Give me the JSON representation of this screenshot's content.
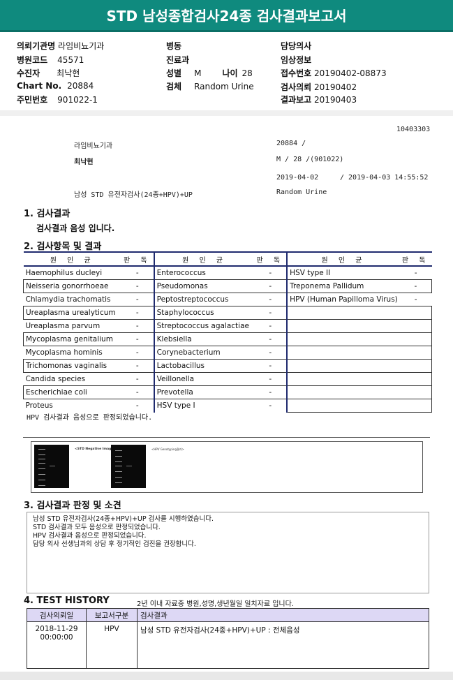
{
  "title": "STD 남성종합검사24종 검사결과보고서",
  "header": {
    "hospital_label": "의뢰기관명",
    "hospital": "라임비뇨기과",
    "code_label": "병원코드",
    "code": "45571",
    "patient_label": "수진자",
    "patient": "최낙현",
    "chart_label": "Chart No.",
    "chart": "20884",
    "id_label": "주민번호",
    "id": "901022-1",
    "ward_label": "병동",
    "dept_label": "진료과",
    "sex_label": "성별",
    "sex": "M",
    "age_label": "나이",
    "age": "28",
    "specimen_label": "검체",
    "specimen": "Random Urine",
    "doctor_label": "담당의사",
    "clinical_label": "임상정보",
    "receipt_label": "접수번호",
    "receipt": "20190402-08873",
    "request_label": "검사의뢰",
    "request": "20190402",
    "report_label": "결과보고",
    "report": "20190403"
  },
  "sub": {
    "docno": "10403303",
    "hospital": "라임비뇨기과",
    "chart_slash": "20884          /",
    "patient": "최낙현",
    "sexage": "M /   28 /(901022)",
    "date1": "2019-04-02",
    "date2": "/ 2019-04-03 14:55:52",
    "testname": "남성 STD 유전자검사(24종+HPV)+UP",
    "specimen": "Random Urine"
  },
  "sec1": {
    "title": "1. 검사결과",
    "text": "검사결과 음성 입니다."
  },
  "sec2": {
    "title": "2. 검사항목 및 결과",
    "head_cause": "원 인 균",
    "head_judge": "판 독",
    "rows": [
      [
        "Haemophilus ducleyi",
        "-",
        "Enterococcus",
        "-",
        "HSV type II",
        "-"
      ],
      [
        "Neisseria gonorrhoeae",
        "-",
        "Pseudomonas",
        "-",
        "Treponema Pallidum",
        "-"
      ],
      [
        "Chlamydia trachomatis",
        "-",
        "Peptostreptococcus",
        "-",
        "HPV (Human Papilloma Virus)",
        "-"
      ],
      [
        "Ureaplasma urealyticum",
        "-",
        "Staphylococcus",
        "-",
        "",
        ""
      ],
      [
        "Ureaplasma parvum",
        "-",
        "Streptococcus agalactiae",
        "-",
        "",
        ""
      ],
      [
        "Mycoplasma genitalium",
        "-",
        "Klebsiella",
        "-",
        "",
        ""
      ],
      [
        "Mycoplasma hominis",
        "-",
        "Corynebacterium",
        "-",
        "",
        ""
      ],
      [
        "Trichomonas vaginalis",
        "-",
        "Lactobacillus",
        "-",
        "",
        ""
      ],
      [
        "Candida species",
        "-",
        "Veillonella",
        "-",
        "",
        ""
      ],
      [
        "Escherichiae coli",
        "-",
        "Prevotella",
        "-",
        "",
        ""
      ],
      [
        "Proteus",
        "-",
        "HSV type I",
        "-",
        "",
        ""
      ]
    ],
    "hpv_note": "HPV 검사결과 음성으로 판정되었습니다."
  },
  "images": {
    "std_label": "<STD Negative Image>",
    "hpv_label": "<HPV Genotyping결과>"
  },
  "sec3": {
    "title": "3. 검사결과 판정 및 소견",
    "lines": [
      "남성 STD 유전자검사(24종+HPV)+UP 검사를 시행하였습니다.",
      "STD 검사결과 모두 음성으로 판정되었습니다.",
      "HPV 검사결과 음성으로 판정되었습니다.",
      "담당 의사 선생님과의 상담 후 정기적인 검진을 권장합니다."
    ]
  },
  "sec4": {
    "title": "4. TEST HISTORY",
    "note": "2년 이내 자료중 병원,성명,생년월일 일치자료 입니다.",
    "col_date": "검사의뢰일",
    "col_type": "보고서구분",
    "col_result": "검사결과",
    "date": "2018-11-29",
    "time": "00:00:00",
    "type": "HPV",
    "result": "남성 STD 유전자검사(24종+HPV)+UP : 전체음성"
  }
}
